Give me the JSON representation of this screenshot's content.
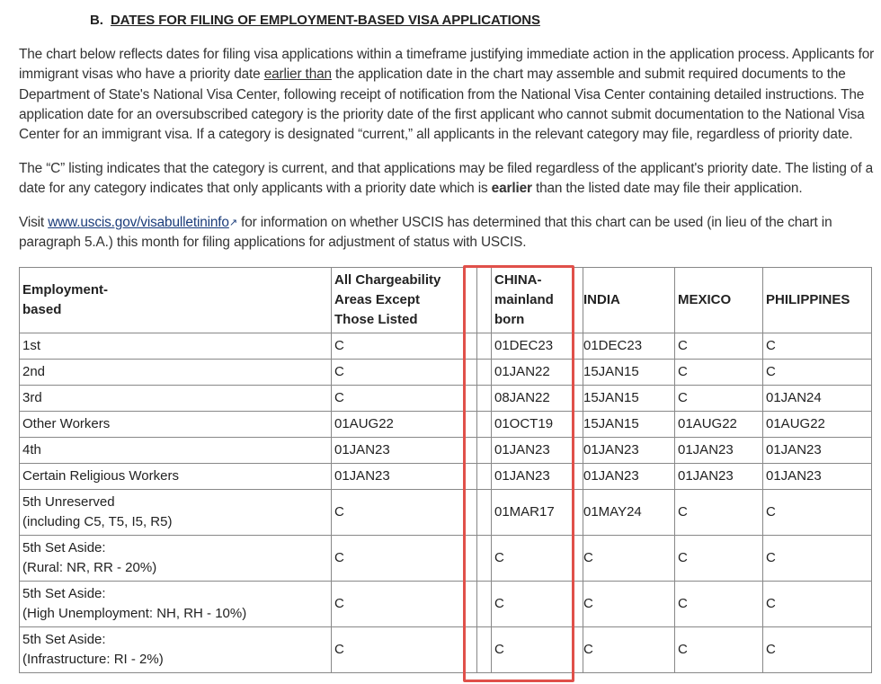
{
  "section": {
    "label": "B.",
    "title": "DATES FOR FILING OF EMPLOYMENT-BASED VISA APPLICATIONS"
  },
  "paragraph1": {
    "part1": "The chart below reflects dates for filing visa applications within a timeframe justifying immediate action in the application process. Applicants for immigrant visas who have a priority date ",
    "underlined": "earlier than",
    "part2": " the application date in the chart may assemble and submit required documents to the Department of State's National Visa Center, following receipt of notification from the National Visa Center containing detailed instructions. The application date for an oversubscribed category is the priority date of the first applicant who cannot submit documentation to the National Visa Center for an immigrant visa. If a category is designated “current,” all applicants in the relevant category may file, regardless of priority date."
  },
  "paragraph2": {
    "part1": "The “C” listing indicates that the category is current, and that applications may be filed regardless of the applicant's priority date. The listing of a date for any category indicates that only applicants with a priority date which is ",
    "bold": "earlier",
    "part2": " than the listed date may file their application."
  },
  "paragraph3": {
    "part1": "Visit ",
    "link": "www.uscis.gov/visabulletininfo",
    "part2": " for information on whether USCIS has determined that this chart can be used (in lieu of the chart in paragraph 5.A.) this month for filing applications for adjustment of status with USCIS."
  },
  "table": {
    "headers": {
      "category": "Employment-\nbased",
      "all": "All Chargeability\nAreas Except\nThose Listed",
      "china": "CHINA-\nmainland\nborn",
      "india": "INDIA",
      "mexico": "MEXICO",
      "philippines": "PHILIPPINES"
    },
    "rows": [
      {
        "category": "1st",
        "all": "C",
        "china": "01DEC23",
        "india": "01DEC23",
        "mexico": "C",
        "philippines": "C"
      },
      {
        "category": "2nd",
        "all": "C",
        "china": "01JAN22",
        "india": "15JAN15",
        "mexico": "C",
        "philippines": "C"
      },
      {
        "category": "3rd",
        "all": "C",
        "china": "08JAN22",
        "india": "15JAN15",
        "mexico": "C",
        "philippines": "01JAN24"
      },
      {
        "category": "Other Workers",
        "all": "01AUG22",
        "china": "01OCT19",
        "india": "15JAN15",
        "mexico": "01AUG22",
        "philippines": "01AUG22"
      },
      {
        "category": "4th",
        "all": "01JAN23",
        "china": "01JAN23",
        "india": "01JAN23",
        "mexico": "01JAN23",
        "philippines": "01JAN23"
      },
      {
        "category": "Certain Religious Workers",
        "all": "01JAN23",
        "china": "01JAN23",
        "india": "01JAN23",
        "mexico": "01JAN23",
        "philippines": "01JAN23"
      },
      {
        "category": "5th Unreserved\n(including C5, T5, I5, R5)",
        "all": "C",
        "china": "01MAR17",
        "india": "01MAY24",
        "mexico": "C",
        "philippines": "C"
      },
      {
        "category": "5th Set Aside:\n(Rural: NR, RR - 20%)",
        "all": "C",
        "china": "C",
        "india": "C",
        "mexico": "C",
        "philippines": "C"
      },
      {
        "category": "5th Set Aside:\n(High Unemployment: NH, RH - 10%)",
        "all": "C",
        "china": "C",
        "india": "C",
        "mexico": "C",
        "philippines": "C"
      },
      {
        "category": "5th Set Aside:\n(Infrastructure: RI - 2%)",
        "all": "C",
        "china": "C",
        "india": "C",
        "mexico": "C",
        "philippines": "C"
      }
    ]
  },
  "highlight": {
    "color": "#e0504a",
    "target_column": "china"
  }
}
